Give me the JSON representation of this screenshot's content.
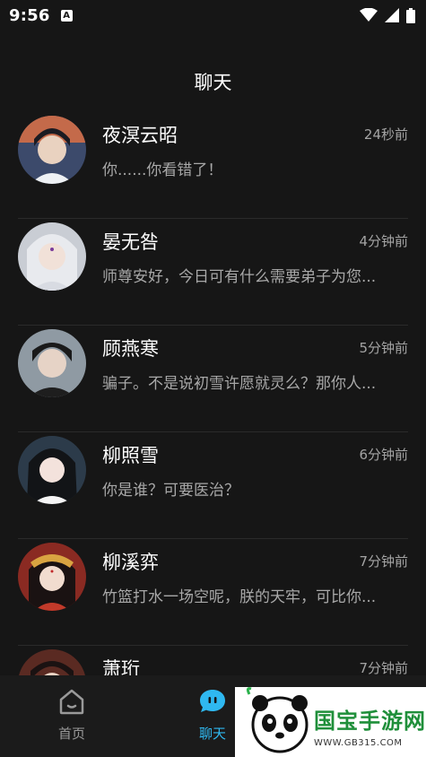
{
  "status_bar": {
    "time": "9:56",
    "badge": "A"
  },
  "header": {
    "title": "聊天"
  },
  "chats": [
    {
      "name": "夜溟云昭",
      "time": "24秒前",
      "preview": "你......你看错了！"
    },
    {
      "name": "晏无咎",
      "time": "4分钟前",
      "preview": "师尊安好，今日可有什么需要弟子为您..."
    },
    {
      "name": "顾燕寒",
      "time": "5分钟前",
      "preview": "骗子。不是说初雪许愿就灵么？那你人..."
    },
    {
      "name": "柳照雪",
      "time": "6分钟前",
      "preview": "你是谁？可要医治？"
    },
    {
      "name": "柳溪弈",
      "time": "7分钟前",
      "preview": "竹篮打水一场空呢，朕的天牢，可比你..."
    },
    {
      "name": "萧珩",
      "time": "7分钟前",
      "preview": ""
    }
  ],
  "tabs": {
    "home": "首页",
    "chat": "聊天"
  },
  "watermark": {
    "title": "国宝手游网",
    "url": "WWW.GB315.COM"
  }
}
